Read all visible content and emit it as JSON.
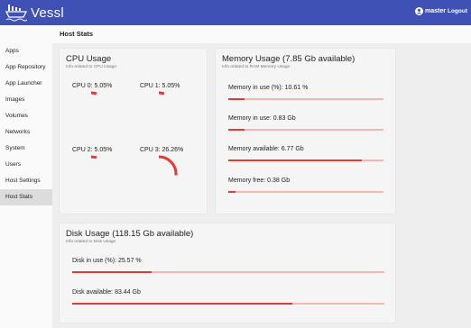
{
  "app": {
    "name": "Vessl",
    "user": "master",
    "logout_label": "Logout"
  },
  "page": {
    "title": "Host Stats"
  },
  "sidebar": {
    "items": [
      {
        "label": "Apps",
        "active": false
      },
      {
        "label": "App Repository",
        "active": false
      },
      {
        "label": "App Launcher",
        "active": false
      },
      {
        "label": "Images",
        "active": false
      },
      {
        "label": "Volumes",
        "active": false
      },
      {
        "label": "Networks",
        "active": false
      },
      {
        "label": "System",
        "active": false
      },
      {
        "label": "Users",
        "active": false
      },
      {
        "label": "Host Settings",
        "active": false
      },
      {
        "label": "Host Stats",
        "active": true
      }
    ]
  },
  "cpu": {
    "title": "CPU Usage",
    "subtitle": "Info related to CPU Usage",
    "cores": [
      {
        "label": "CPU 0: 5.05%",
        "percent": 5.05
      },
      {
        "label": "CPU 1: 5.05%",
        "percent": 5.05
      },
      {
        "label": "CPU 2: 5.05%",
        "percent": 5.05
      },
      {
        "label": "CPU 3: 26.26%",
        "percent": 26.26
      }
    ]
  },
  "memory": {
    "title": "Memory Usage (7.85 Gb available)",
    "subtitle": "Info related to RAM Memory Usage",
    "stats": [
      {
        "label": "Memory in use (%): 10.61 %",
        "fraction": 0.1061
      },
      {
        "label": "Memory in use: 0.83 Gb",
        "fraction": 0.106
      },
      {
        "label": "Memory available: 6.77 Gb",
        "fraction": 0.862
      },
      {
        "label": "Memory free: 0.38 Gb",
        "fraction": 0.048
      }
    ]
  },
  "disk": {
    "title": "Disk Usage (118.15 Gb available)",
    "subtitle": "Info related to Disk Usage",
    "stats": [
      {
        "label": "Disk in use (%): 25.57 %",
        "fraction": 0.2557
      },
      {
        "label": "Disk available: 83.44 Gb",
        "fraction": 0.706
      }
    ]
  },
  "colors": {
    "header": "#3f51b5",
    "accent": "#e53935",
    "track": "#f4b6b0"
  },
  "icons": {
    "brand": "ship-icon",
    "user": "account-circle-icon"
  }
}
